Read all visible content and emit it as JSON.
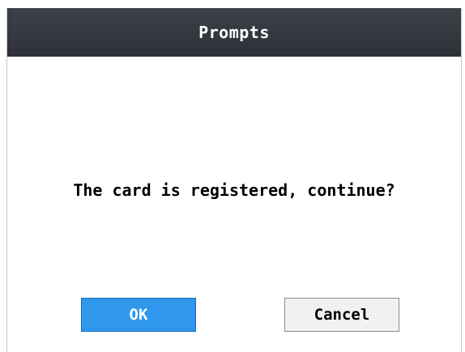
{
  "dialog": {
    "title": "Prompts",
    "message": "The card is registered, continue?",
    "ok_label": "OK",
    "cancel_label": "Cancel",
    "colors": {
      "titlebar": "#33363d",
      "ok_button": "#2f97ec",
      "cancel_button": "#f1f1f1"
    }
  }
}
